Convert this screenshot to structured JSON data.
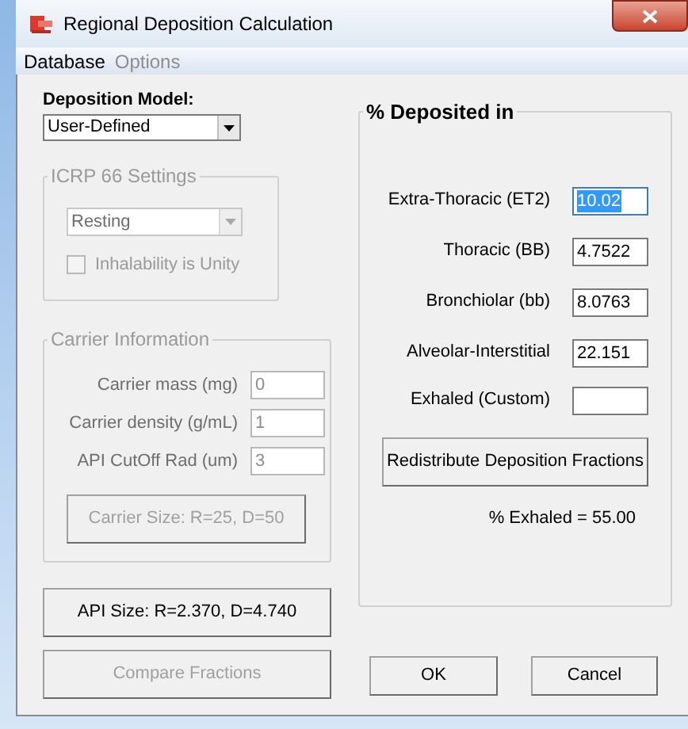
{
  "window": {
    "title": "Regional Deposition Calculation"
  },
  "menu": [
    {
      "label": "Database",
      "disabled": false
    },
    {
      "label": "Options",
      "disabled": true
    }
  ],
  "deposition_model": {
    "label": "Deposition Model:",
    "value": "User-Defined"
  },
  "icrp66": {
    "title": "ICRP 66 Settings",
    "disabled": true,
    "activity": "Resting",
    "inhalability": {
      "label": "Inhalability is Unity",
      "checked": false
    }
  },
  "carrier": {
    "title": "Carrier Information",
    "disabled": true,
    "fields": [
      {
        "label": "Carrier mass (mg)",
        "value": "0"
      },
      {
        "label": "Carrier density (g/mL)",
        "value": "1"
      },
      {
        "label": "API CutOff Rad (um)",
        "value": "3"
      }
    ],
    "button": "Carrier Size: R=25, D=50"
  },
  "api_button": {
    "label": "API Size: R=2.370, D=4.740",
    "disabled": false
  },
  "compare_button": {
    "label": "Compare Fractions",
    "disabled": true
  },
  "deposited": {
    "title": "% Deposited in",
    "fields": [
      {
        "label": "Extra-Thoracic (ET2)",
        "value": "10.02",
        "selected": true
      },
      {
        "label": "Thoracic (BB)",
        "value": "4.7522",
        "selected": false
      },
      {
        "label": "Bronchiolar (bb)",
        "value": "8.0763",
        "selected": false
      },
      {
        "label": "Alveolar-Interstitial",
        "value": "22.151",
        "selected": false
      },
      {
        "label": "Exhaled (Custom)",
        "selected": false
      }
    ],
    "button": "Redistribute Deposition Fractions",
    "exhaled": "% Exhaled = 55.00"
  },
  "buttons": [
    {
      "label": "OK"
    },
    {
      "label": "Cancel"
    }
  ]
}
